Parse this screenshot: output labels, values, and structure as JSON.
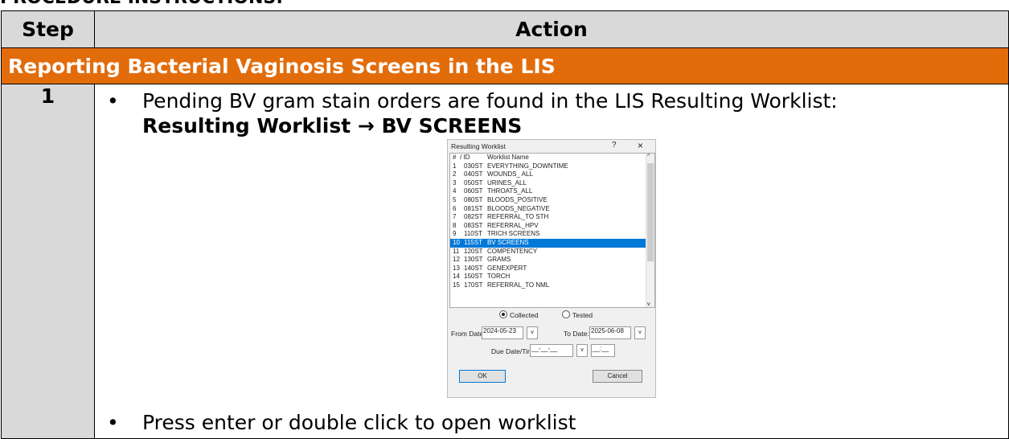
{
  "page": {
    "top_heading": "PROCEDURE INSTRUCTIONS:"
  },
  "table": {
    "col_step": "Step",
    "col_action": "Action",
    "section_title": "Reporting Bacterial Vaginosis Screens in the LIS",
    "step_number": "1",
    "bullet1": "Pending BV gram stain orders are found in the LIS Resulting Worklist:",
    "bullet1_bold": "Resulting Worklist → BV SCREENS",
    "bullet2": "Press enter or double click to open worklist"
  },
  "dialog": {
    "title": "Resulting Worklist",
    "help": "?",
    "close": "×",
    "headers": {
      "num": "#",
      "id": "/ ID",
      "name": "Worklist Name"
    },
    "rows": [
      {
        "num": "1",
        "id": "030ST",
        "name": "EVERYTHING_DOWNTIME"
      },
      {
        "num": "2",
        "id": "040ST",
        "name": "WOUNDS_ ALL"
      },
      {
        "num": "3",
        "id": "050ST",
        "name": "URINES_ALL"
      },
      {
        "num": "4",
        "id": "060ST",
        "name": "THROATS_ALL"
      },
      {
        "num": "5",
        "id": "080ST",
        "name": "BLOODS_POSITIVE"
      },
      {
        "num": "6",
        "id": "081ST",
        "name": "BLOODS_NEGATIVE"
      },
      {
        "num": "7",
        "id": "082ST",
        "name": "REFERRAL_TO STH"
      },
      {
        "num": "8",
        "id": "083ST",
        "name": "REFERRAL_HPV"
      },
      {
        "num": "9",
        "id": "110ST",
        "name": "TRICH SCREENS"
      },
      {
        "num": "10",
        "id": "115ST",
        "name": "BV SCREENS"
      },
      {
        "num": "11",
        "id": "120ST",
        "name": "COMPENTENCY"
      },
      {
        "num": "12",
        "id": "130ST",
        "name": "GRAMS"
      },
      {
        "num": "13",
        "id": "140ST",
        "name": "GENEXPERT"
      },
      {
        "num": "14",
        "id": "150ST",
        "name": "TORCH"
      },
      {
        "num": "15",
        "id": "170ST",
        "name": "REFERRAL_TO NML"
      }
    ],
    "selected_index": 9,
    "radio_collected": "Collected",
    "radio_tested": "Tested",
    "from_date_label": "From Date:",
    "from_date_value": "2024-05-23",
    "to_date_label": "To Date:",
    "to_date_value": "2025-06-08",
    "due_label": "Due Date/Time:",
    "due_date_value": "__-__-__",
    "due_time_value": "__:__",
    "ok": "OK",
    "cancel": "Cancel"
  }
}
